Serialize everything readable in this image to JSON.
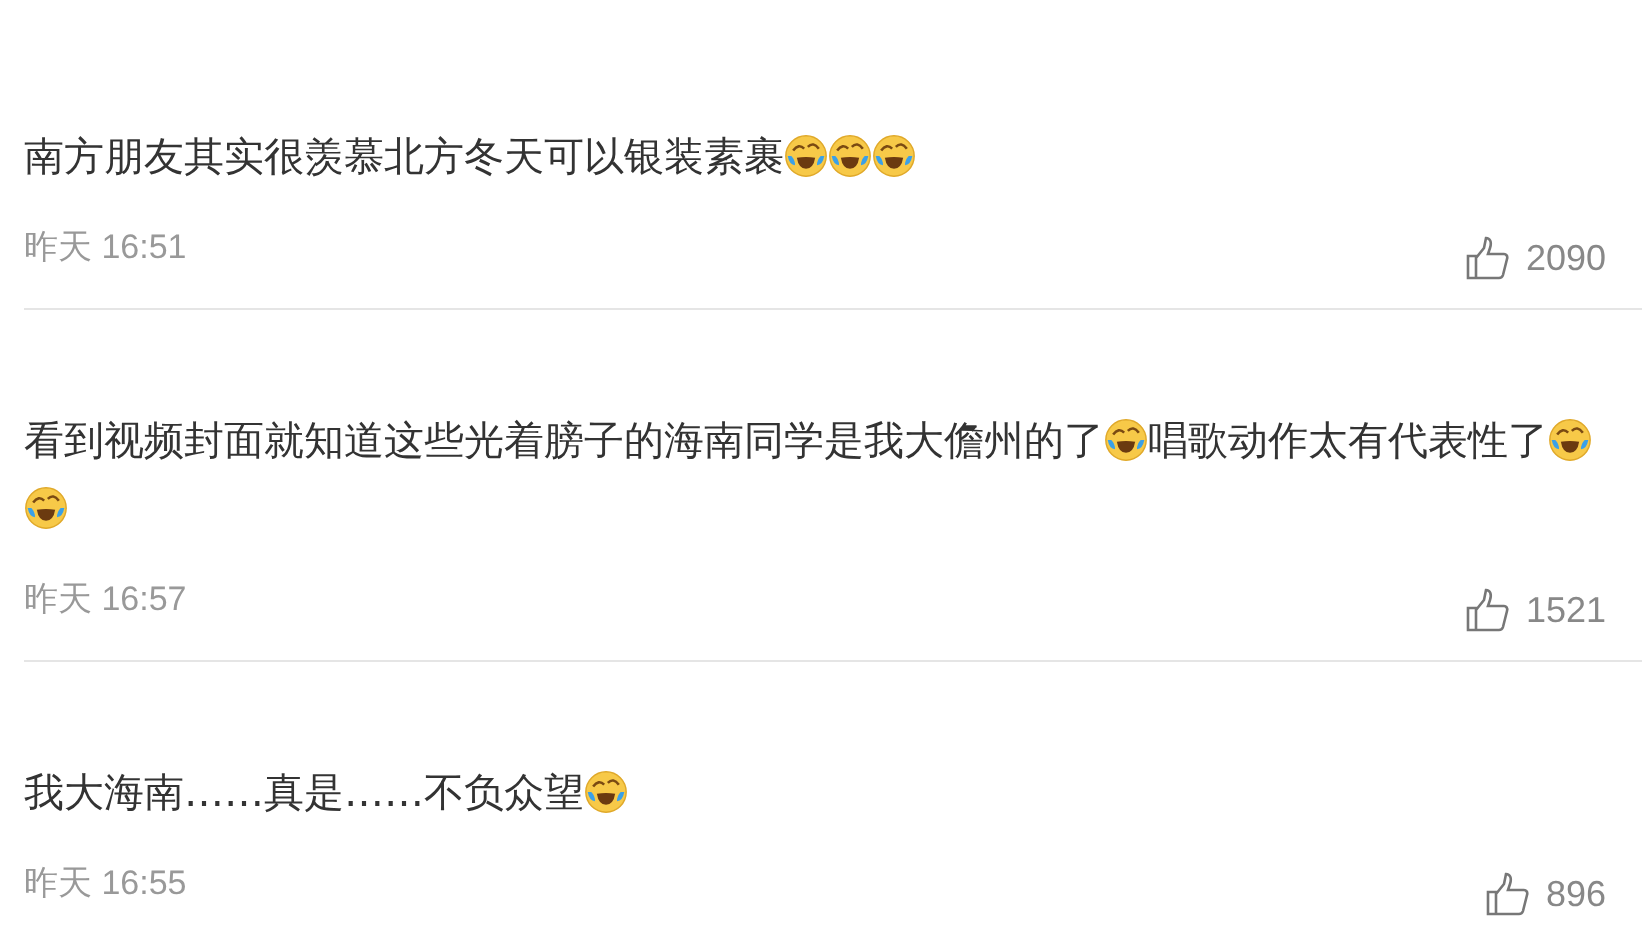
{
  "comments": [
    {
      "content": [
        {
          "kind": "text",
          "text": "南方朋友其实很羡慕北方冬天可以银装素裹"
        },
        {
          "kind": "emoji"
        },
        {
          "kind": "emoji"
        },
        {
          "kind": "emoji"
        }
      ],
      "time": "昨天 16:51",
      "likes": "2090"
    },
    {
      "content": [
        {
          "kind": "text",
          "text": "看到视频封面就知道这些光着膀子的海南同学是我大儋州的了"
        },
        {
          "kind": "emoji"
        },
        {
          "kind": "text",
          "text": "唱歌动作太有代表性了"
        },
        {
          "kind": "emoji"
        },
        {
          "kind": "emoji"
        }
      ],
      "time": "昨天 16:57",
      "likes": "1521"
    },
    {
      "content": [
        {
          "kind": "text",
          "text": "我大海南……真是……不负众望"
        },
        {
          "kind": "emoji"
        }
      ],
      "time": "昨天 16:55",
      "likes": "896"
    }
  ]
}
